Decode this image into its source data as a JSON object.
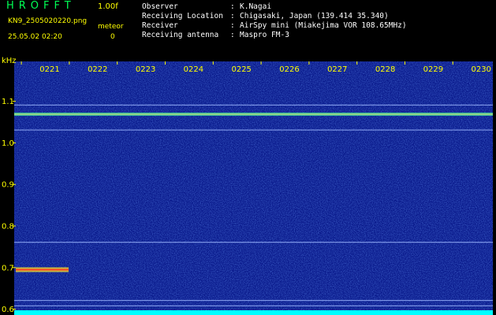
{
  "header": {
    "logo": "HROFFT",
    "version": "1.00f",
    "filename": "KN9_2505020220.png",
    "meteor_label": "meteor",
    "timestamp": "25.05.02 02:20",
    "meteor_count": "0",
    "info": [
      {
        "key": "Observer",
        "value": "K.Nagai"
      },
      {
        "key": "Receiving Location",
        "value": "Chigasaki, Japan (139.414 35.340)"
      },
      {
        "key": "Receiver",
        "value": "AirSpy mini (Miakejima VOR 108.65MHz)"
      },
      {
        "key": "Receiving antenna",
        "value": "Maspro FM-3"
      }
    ]
  },
  "colors": {
    "background": "#000000",
    "spectrogram": "#0a1a8c",
    "label": "#ffff00",
    "trace": "#00ffff"
  },
  "chart_data": {
    "type": "heatmap",
    "ylabel": "kHz",
    "xlabel": "",
    "x_ticks": [
      "0221",
      "0222",
      "0223",
      "0224",
      "0225",
      "0226",
      "0227",
      "0228",
      "0229",
      "0230"
    ],
    "y_ticks": [
      "1.1",
      "1.0",
      "0.9",
      "0.8",
      "0.7",
      "0.6"
    ],
    "ylim": [
      0.585,
      1.195
    ],
    "horizontal_lines_khz": [
      1.09,
      1.068,
      1.03,
      0.76,
      0.62,
      0.607
    ],
    "signals": [
      {
        "time_start": "0220",
        "time_end": "0221",
        "freq_khz": 0.694
      }
    ]
  }
}
